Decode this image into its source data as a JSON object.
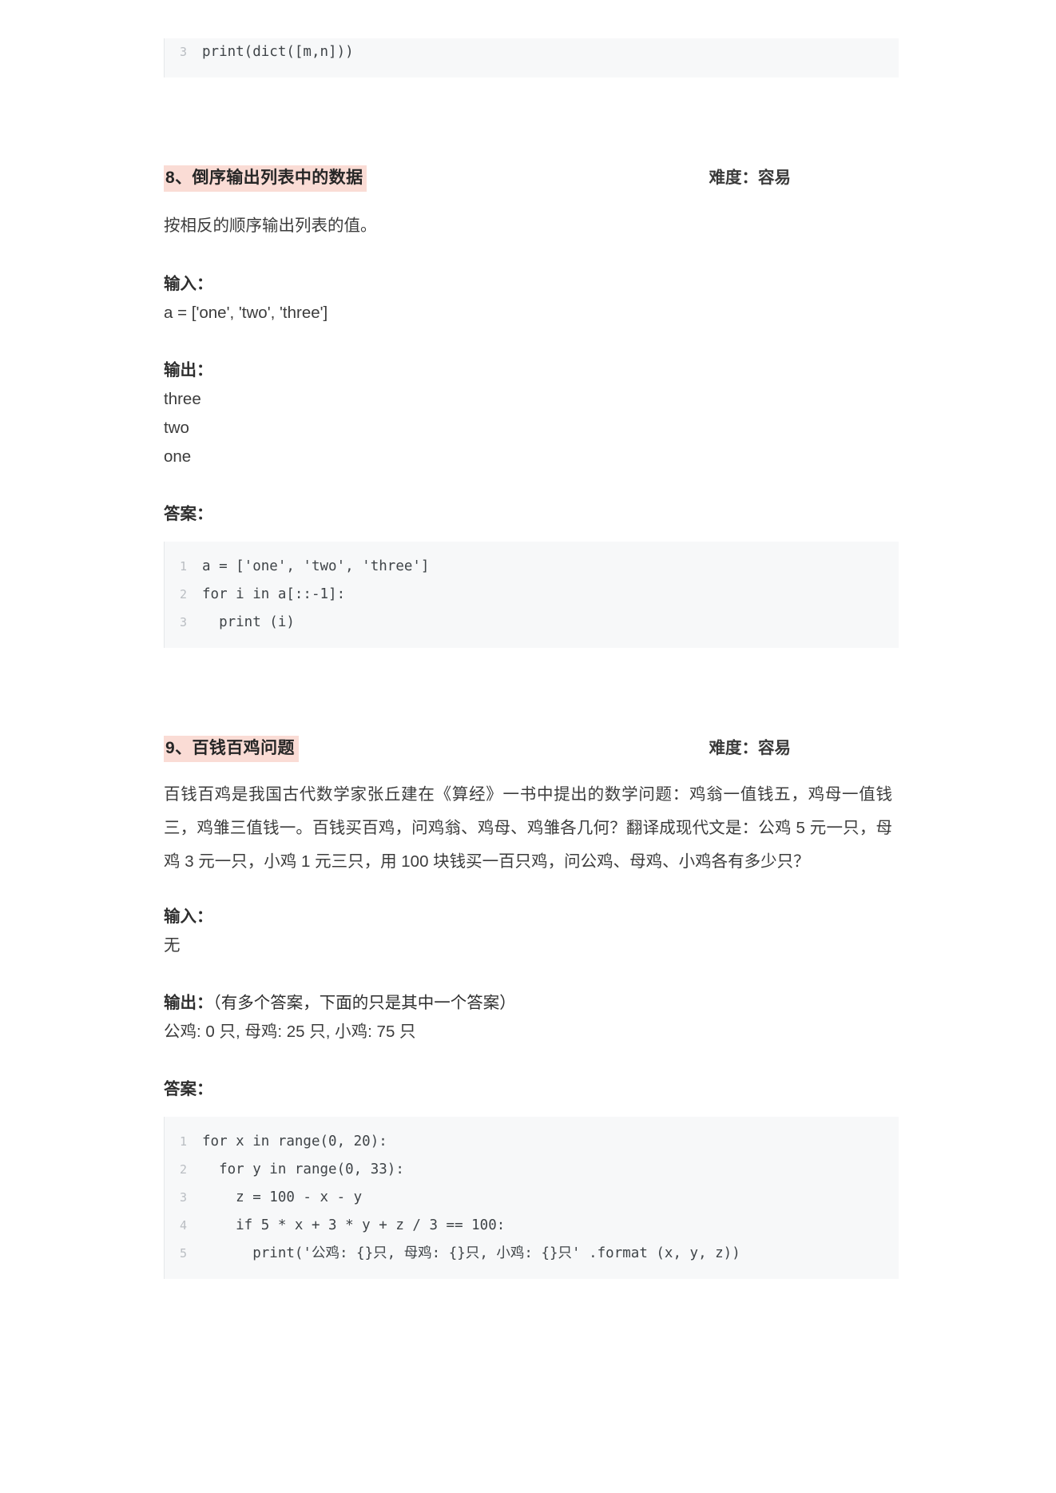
{
  "top_code_block": {
    "lines": [
      {
        "number": "3",
        "text": "print(dict([m,n]))"
      }
    ]
  },
  "sections": [
    {
      "title": "8、倒序输出列表中的数据",
      "difficulty": "难度：容易",
      "description": "按相反的顺序输出列表的值。",
      "input_label": "输入：",
      "input_value": "a = ['one', 'two', 'three']",
      "output_label": "输出：",
      "output_note": "",
      "output_lines": [
        "three",
        "two",
        "one"
      ],
      "answer_label": "答案：",
      "code": {
        "lines": [
          {
            "number": "1",
            "text": "a = ['one', 'two', 'three']"
          },
          {
            "number": "2",
            "text": "for i in a[::-1]:"
          },
          {
            "number": "3",
            "text": "  print (i)"
          }
        ]
      }
    },
    {
      "title": "9、百钱百鸡问题",
      "difficulty": "难度：容易",
      "description": "百钱百鸡是我国古代数学家张丘建在《算经》一书中提出的数学问题：鸡翁一值钱五，鸡母一值钱三，鸡雏三值钱一。百钱买百鸡，问鸡翁、鸡母、鸡雏各几何？翻译成现代文是：公鸡 5 元一只，母鸡 3 元一只，小鸡 1 元三只，用 100 块钱买一百只鸡，问公鸡、母鸡、小鸡各有多少只？",
      "input_label": "输入：",
      "input_value": "无",
      "output_label": "输出：",
      "output_note": "（有多个答案，下面的只是其中一个答案）",
      "output_lines": [
        "公鸡: 0 只, 母鸡: 25 只, 小鸡: 75 只"
      ],
      "answer_label": "答案：",
      "code": {
        "lines": [
          {
            "number": "1",
            "text": "for x in range(0, 20):"
          },
          {
            "number": "2",
            "text": "  for y in range(0, 33):"
          },
          {
            "number": "3",
            "text": "    z = 100 - x - y"
          },
          {
            "number": "4",
            "text": "    if 5 * x + 3 * y + z / 3 == 100:"
          },
          {
            "number": "5",
            "text": "      print('公鸡: {}只, 母鸡: {}只, 小鸡: {}只' .format (x, y, z))"
          }
        ]
      }
    }
  ],
  "colors": {
    "highlight": "#fadcd5",
    "code_background": "#f7f8f9",
    "line_number": "#b9bdc2",
    "text": "#3c3c3c"
  }
}
